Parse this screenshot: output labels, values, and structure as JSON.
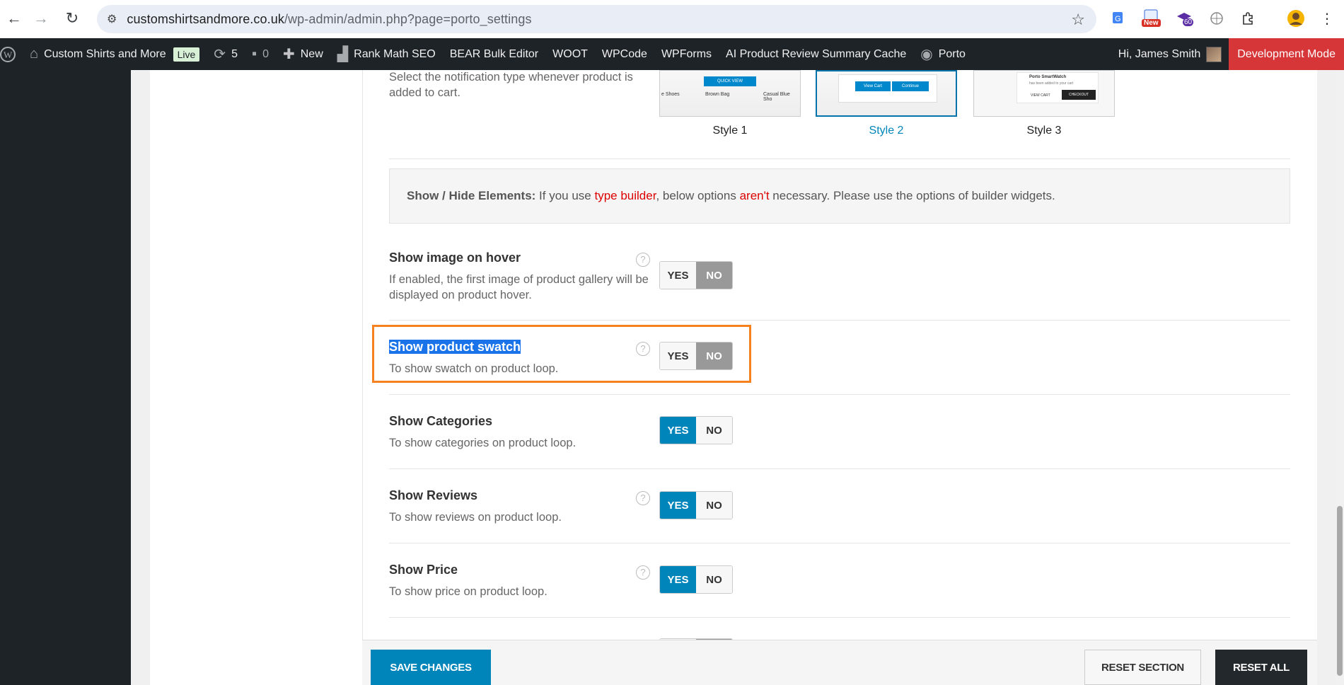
{
  "browser": {
    "url_host": "customshirtsandmore.co.uk",
    "url_path": "/wp-admin/admin.php?page=porto_settings",
    "ext_new_badge": "New",
    "ext_count_badge": "60"
  },
  "admin_bar": {
    "site_name": "Custom Shirts and More",
    "live_badge": "Live",
    "updates_count": "5",
    "comments_count": "0",
    "new_label": "New",
    "items": [
      "Rank Math SEO",
      "BEAR Bulk Editor",
      "WOOT",
      "WPCode",
      "WPForms",
      "AI Product Review Summary Cache"
    ],
    "porto_label": "Porto",
    "greeting": "Hi, James Smith",
    "dev_mode": "Development Mode"
  },
  "notification": {
    "description": "Select the notification type whenever product is added to cart.",
    "styles": [
      {
        "label": "Style 1",
        "selected": false
      },
      {
        "label": "Style 2",
        "selected": true
      },
      {
        "label": "Style 3",
        "selected": false
      }
    ],
    "thumb1_text": [
      "e Shoes",
      "Brown Bag",
      "Casual Blue Sho"
    ],
    "thumb1_quick": "QUICK VIEW",
    "thumb2_view": "View Cart",
    "thumb2_continue": "Continue",
    "thumb3_title": "Porto SmartWatch",
    "thumb3_sub": "has been added to your cart",
    "thumb3_view": "VIEW CART",
    "thumb3_checkout": "CHECKOUT"
  },
  "info_box": {
    "bold": "Show / Hide Elements:",
    "t1": " If you use ",
    "red1": "type builder",
    "t2": ", below options ",
    "red2": "aren't",
    "t3": " necessary. Please use the options of builder widgets."
  },
  "options": [
    {
      "title": "Show image on hover",
      "desc": "If enabled, the first image of product gallery will be displayed on product hover.",
      "value": "NO"
    },
    {
      "title": "Show product swatch",
      "desc": "To show swatch on product loop.",
      "value": "NO"
    },
    {
      "title": "Show Categories",
      "desc": "To show categories on product loop.",
      "value": "YES"
    },
    {
      "title": "Show Reviews",
      "desc": "To show reviews on product loop.",
      "value": "YES"
    },
    {
      "title": "Show Price",
      "desc": "To show price on product loop.",
      "value": "YES"
    }
  ],
  "toggle": {
    "yes": "YES",
    "no": "NO"
  },
  "footer": {
    "save": "SAVE CHANGES",
    "reset_section": "RESET SECTION",
    "reset_all": "RESET ALL"
  }
}
